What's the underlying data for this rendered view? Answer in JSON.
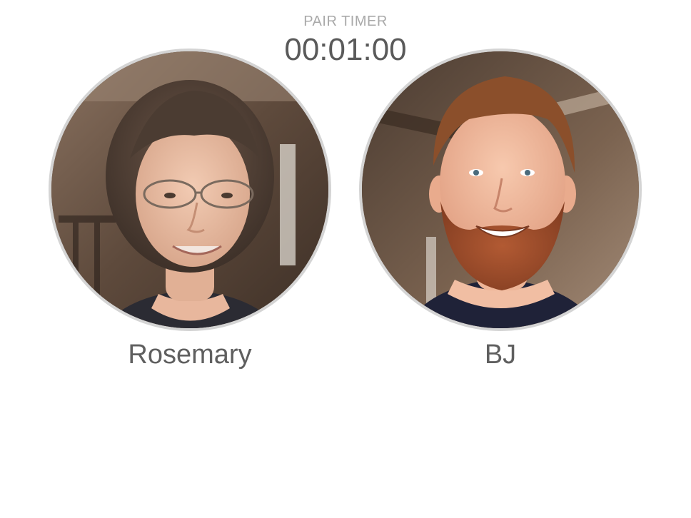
{
  "timer": {
    "label": "PAIR TIMER",
    "value": "00:01:00"
  },
  "pair": [
    {
      "name": "Rosemary",
      "photo": "portrait-photo"
    },
    {
      "name": "BJ",
      "photo": "portrait-photo"
    }
  ],
  "colors": {
    "label": "#a9a9a9",
    "timer": "#5a5a5a",
    "name": "#5f5f5f",
    "avatar_border": "#d4d4d4"
  }
}
